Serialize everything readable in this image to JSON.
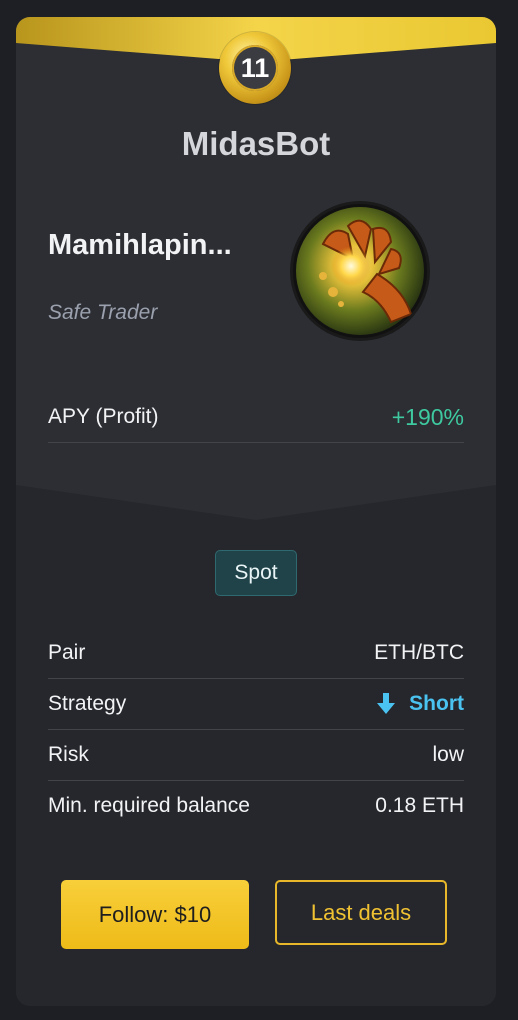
{
  "bot": {
    "rank": "11",
    "name": "MidasBot",
    "user_name": "Mamihlapin...",
    "user_role": "Safe Trader",
    "avatar_icon": "golden-hand-icon"
  },
  "apy": {
    "label": "APY (Profit)",
    "value": "+190%"
  },
  "market_type": "Spot",
  "details": [
    {
      "label": "Pair",
      "value": "ETH/BTC"
    },
    {
      "label": "Strategy",
      "value": "Short",
      "icon": "arrow-down-icon"
    },
    {
      "label": "Risk",
      "value": "low"
    },
    {
      "label": "Min. required balance",
      "value": "0.18 ETH"
    }
  ],
  "buttons": {
    "follow": "Follow: $10",
    "last_deals": "Last deals"
  },
  "colors": {
    "gold": "#f0c232",
    "profit_green": "#3ec9a0",
    "short_blue": "#4ac3f1",
    "card_bg": "#2c2e33"
  }
}
